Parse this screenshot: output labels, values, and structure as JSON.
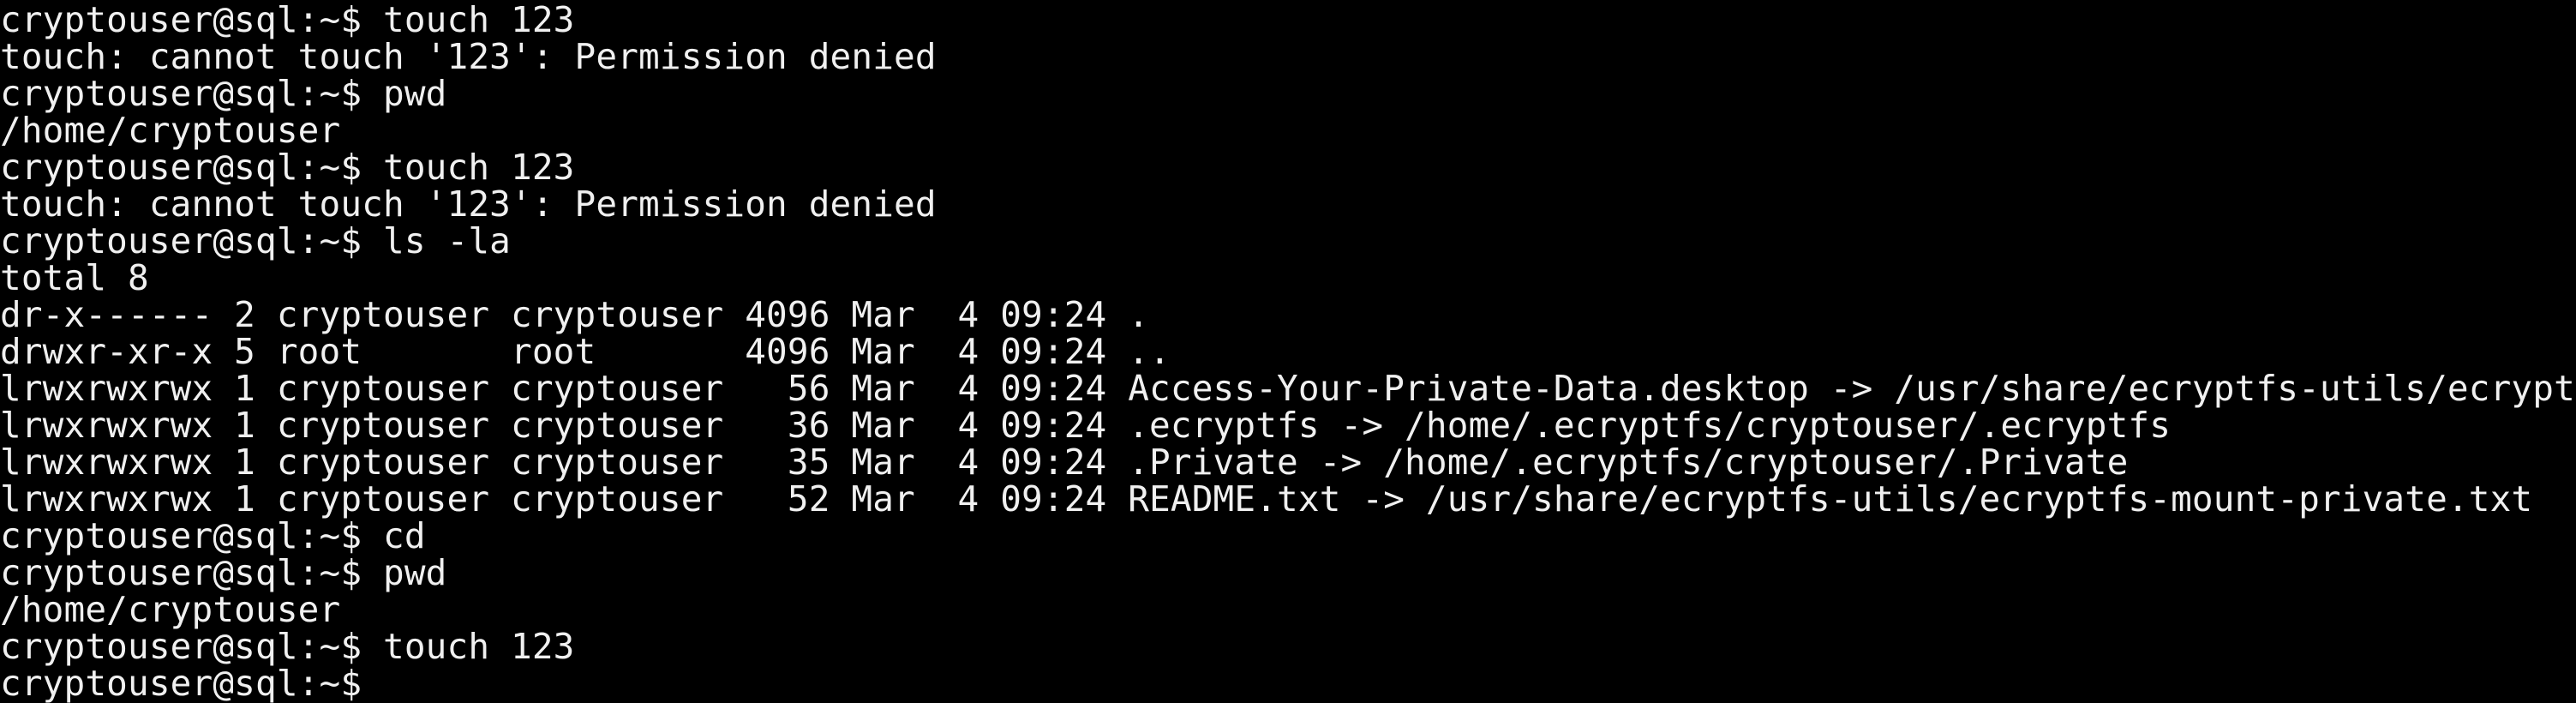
{
  "terminal": {
    "background": "#000000",
    "foreground": "#f0f0f0",
    "lines": [
      "cryptouser@sql:~$ touch 123",
      "touch: cannot touch '123': Permission denied",
      "cryptouser@sql:~$ pwd",
      "/home/cryptouser",
      "cryptouser@sql:~$ touch 123",
      "touch: cannot touch '123': Permission denied",
      "cryptouser@sql:~$ ls -la",
      "total 8",
      "dr-x------ 2 cryptouser cryptouser 4096 Mar  4 09:24 .",
      "drwxr-xr-x 5 root       root       4096 Mar  4 09:24 ..",
      "lrwxrwxrwx 1 cryptouser cryptouser   56 Mar  4 09:24 Access-Your-Private-Data.desktop -> /usr/share/ecryptfs-utils/ecrypt",
      "lrwxrwxrwx 1 cryptouser cryptouser   36 Mar  4 09:24 .ecryptfs -> /home/.ecryptfs/cryptouser/.ecryptfs",
      "lrwxrwxrwx 1 cryptouser cryptouser   35 Mar  4 09:24 .Private -> /home/.ecryptfs/cryptouser/.Private",
      "lrwxrwxrwx 1 cryptouser cryptouser   52 Mar  4 09:24 README.txt -> /usr/share/ecryptfs-utils/ecryptfs-mount-private.txt",
      "cryptouser@sql:~$ cd",
      "cryptouser@sql:~$ pwd",
      "/home/cryptouser",
      "cryptouser@sql:~$ touch 123",
      "cryptouser@sql:~$"
    ]
  }
}
